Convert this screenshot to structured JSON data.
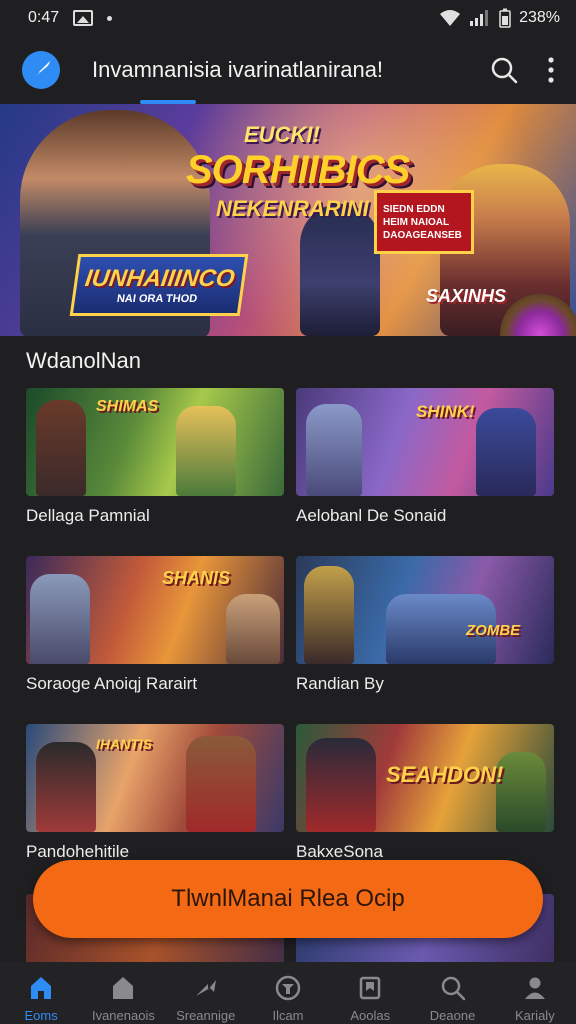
{
  "status_bar": {
    "time": "0:47",
    "battery": "238%"
  },
  "app_bar": {
    "title": "Invamnanisia ivarinatlanirana!",
    "logo_icon": "feather-icon",
    "accent": "#2f8cf4"
  },
  "banner": {
    "headline_top": "EUCKI!",
    "headline_main": "SORHIIBICS",
    "headline_sub": "NEKENRARINI",
    "logo_line1": "IUNHAIIINCO",
    "logo_line2": "NAI ORA THOD",
    "speech_lines": [
      "SIEDN EDDN",
      "HEIM NAIOAL",
      "DAOAGEANSEB"
    ],
    "tag": "SAXINHS"
  },
  "section": {
    "title": "WdanolNan"
  },
  "games": [
    {
      "name": "Dellaga Pamnial",
      "logo": "SHIMAS"
    },
    {
      "name": "Aelobanl De Sonaid",
      "logo": "SHINK!"
    },
    {
      "name": "Soraoge Anoiqj Rarairt",
      "logo": "SHANIS"
    },
    {
      "name": "Randian By",
      "logo": "ZOMBE"
    },
    {
      "name": "Pandohehitile",
      "logo": "IHANTIS"
    },
    {
      "name": "BakxeSona",
      "logo": "SEAHDON!"
    },
    {
      "name": "",
      "logo": ""
    },
    {
      "name": "",
      "logo": ""
    }
  ],
  "cta": {
    "label": "TlwnlManai Rlea Ocip",
    "color": "#f46a14"
  },
  "bottom_nav": {
    "items": [
      {
        "label": "Eoms",
        "icon": "home-filled-icon",
        "active": true
      },
      {
        "label": "Ivanenaois",
        "icon": "home-icon",
        "active": false
      },
      {
        "label": "Sreannige",
        "icon": "share-icon",
        "active": false
      },
      {
        "label": "Ilcam",
        "icon": "team-icon",
        "active": false
      },
      {
        "label": "Aoolas",
        "icon": "bookmark-icon",
        "active": false
      },
      {
        "label": "Deaone",
        "icon": "search-icon",
        "active": false
      },
      {
        "label": "Karialy",
        "icon": "profile-icon",
        "active": false
      }
    ]
  }
}
